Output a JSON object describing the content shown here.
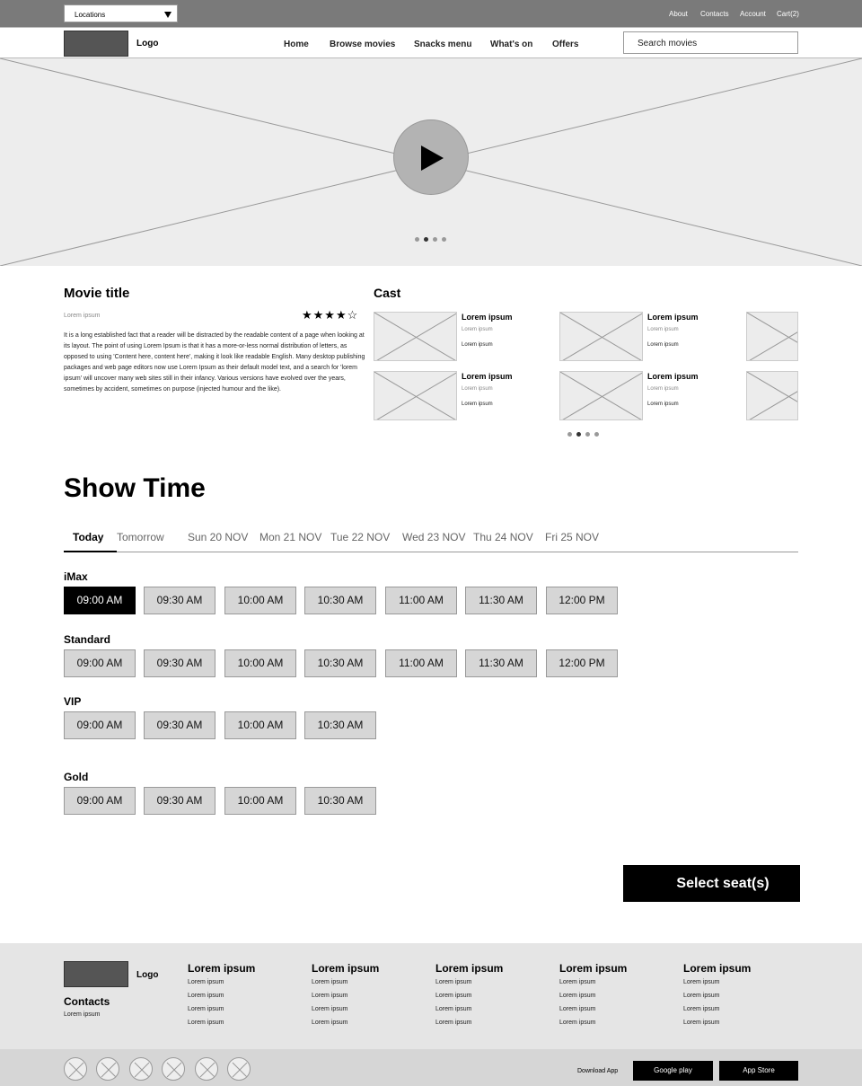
{
  "topbar": {
    "locations": "Locations",
    "links": [
      "About",
      "Contacts",
      "Account",
      "Cart(2)"
    ]
  },
  "header": {
    "logo": "Logo",
    "nav": [
      "Home",
      "Browse movies",
      "Snacks menu",
      "What's on",
      "Offers"
    ],
    "search_placeholder": "Search movies"
  },
  "hero": {
    "slides": 4,
    "active_slide": 2
  },
  "movie": {
    "title": "Movie title",
    "meta": "Lorem ipsum",
    "rating": 4,
    "rating_max": 5,
    "stars": "★★★★☆",
    "description": "It is a long established fact that a reader will be distracted by the readable content of a page when looking at its layout. The point of using Lorem Ipsum is that it has a more-or-less normal distribution of letters, as opposed to using 'Content here, content here', making it look like readable English. Many desktop publishing packages and web page editors now use Lorem Ipsum as their default model text, and a search for 'lorem ipsum' will uncover many web sites still in their infancy. Various versions have evolved over the years, sometimes by accident, sometimes on purpose (injected humour and the like)."
  },
  "cast": {
    "title": "Cast",
    "members": [
      {
        "name": "Lorem ipsum",
        "role": "Lorem ipsum",
        "sub": "Lorem ipsum"
      },
      {
        "name": "Lorem ipsum",
        "role": "Lorem ipsum",
        "sub": "Lorem ipsum"
      },
      {
        "name": "Lorem ipsum",
        "role": "Lorem ipsum",
        "sub": "Lorem ipsum"
      },
      {
        "name": "Lorem ipsum",
        "role": "Lorem ipsum",
        "sub": "Lorem ipsum"
      }
    ],
    "pages": 4,
    "active_page": 2
  },
  "showtime": {
    "title": "Show Time",
    "tabs": [
      "Today",
      "Tomorrow",
      "Sun 20 NOV",
      "Mon 21 NOV",
      "Tue 22 NOV",
      "Wed 23 NOV",
      "Thu 24 NOV",
      "Fri 25 NOV"
    ],
    "active_tab": "Today",
    "tiers": [
      {
        "name": "iMax",
        "times": [
          "09:00 AM",
          "09:30 AM",
          "10:00 AM",
          "10:30 AM",
          "11:00 AM",
          "11:30 AM",
          "12:00 PM"
        ],
        "selected": "09:00 AM"
      },
      {
        "name": "Standard",
        "times": [
          "09:00 AM",
          "09:30 AM",
          "10:00 AM",
          "10:30 AM",
          "11:00 AM",
          "11:30 AM",
          "12:00 PM"
        ]
      },
      {
        "name": "VIP",
        "times": [
          "09:00 AM",
          "09:30 AM",
          "10:00 AM",
          "10:30 AM"
        ]
      },
      {
        "name": "Gold",
        "times": [
          "09:00 AM",
          "09:30 AM",
          "10:00 AM",
          "10:30 AM"
        ]
      }
    ],
    "select_button": "Select seat(s)"
  },
  "footer": {
    "logo": "Logo",
    "contacts_title": "Contacts",
    "contacts_text": "Lorem ipsum",
    "columns": [
      {
        "title": "Lorem ipsum",
        "items": [
          "Lorem ipsum",
          "Lorem ipsum",
          "Lorem ipsum",
          "Lorem ipsum"
        ]
      },
      {
        "title": "Lorem ipsum",
        "items": [
          "Lorem ipsum",
          "Lorem ipsum",
          "Lorem ipsum",
          "Lorem ipsum"
        ]
      },
      {
        "title": "Lorem ipsum",
        "items": [
          "Lorem ipsum",
          "Lorem ipsum",
          "Lorem ipsum",
          "Lorem ipsum"
        ]
      },
      {
        "title": "Lorem ipsum",
        "items": [
          "Lorem ipsum",
          "Lorem ipsum",
          "Lorem ipsum",
          "Lorem ipsum"
        ]
      },
      {
        "title": "Lorem ipsum",
        "items": [
          "Lorem ipsum",
          "Lorem ipsum",
          "Lorem ipsum",
          "Lorem ipsum"
        ]
      }
    ],
    "social_icons": [
      "social-icon-1",
      "social-icon-2",
      "social-icon-3",
      "social-icon-4",
      "social-icon-5",
      "social-icon-6"
    ],
    "download_label": "Download App",
    "google_play": "Google play",
    "app_store": "App Store"
  }
}
